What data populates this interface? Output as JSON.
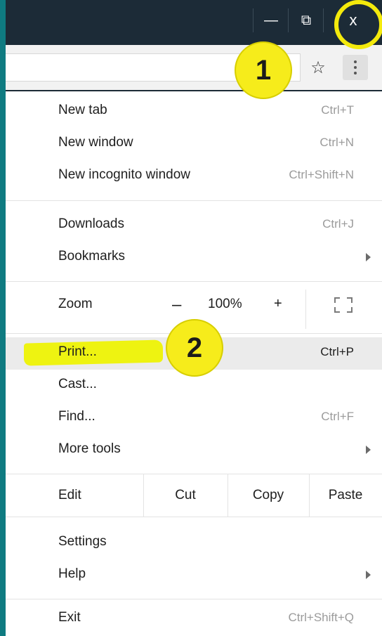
{
  "window_controls": {
    "minimize": "—",
    "restore": "⧉",
    "close": "x"
  },
  "toolbar": {
    "star_icon": "☆"
  },
  "annotations": {
    "step1": "1",
    "step2": "2",
    "highlight_color": "#f4ea0c"
  },
  "menu": {
    "new_tab": {
      "label": "New tab",
      "shortcut": "Ctrl+T"
    },
    "new_window": {
      "label": "New window",
      "shortcut": "Ctrl+N"
    },
    "new_incognito": {
      "label": "New incognito window",
      "shortcut": "Ctrl+Shift+N"
    },
    "downloads": {
      "label": "Downloads",
      "shortcut": "Ctrl+J"
    },
    "bookmarks": {
      "label": "Bookmarks"
    },
    "zoom": {
      "label": "Zoom",
      "minus": "–",
      "level": "100%",
      "plus": "+"
    },
    "print": {
      "label": "Print...",
      "shortcut": "Ctrl+P"
    },
    "cast": {
      "label": "Cast..."
    },
    "find": {
      "label": "Find...",
      "shortcut": "Ctrl+F"
    },
    "more_tools": {
      "label": "More tools"
    },
    "edit": {
      "label": "Edit",
      "cut": "Cut",
      "copy": "Copy",
      "paste": "Paste"
    },
    "settings": {
      "label": "Settings"
    },
    "help": {
      "label": "Help"
    },
    "exit": {
      "label": "Exit",
      "shortcut": "Ctrl+Shift+Q"
    }
  }
}
